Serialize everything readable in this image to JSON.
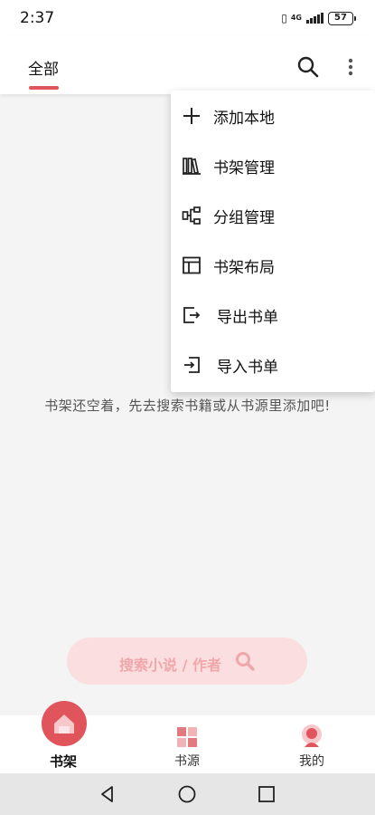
{
  "status_bar": {
    "time": "2:37",
    "network": "4G",
    "battery": "57"
  },
  "header": {
    "tab_label": "全部",
    "accent_color": "#e0555c"
  },
  "menu": {
    "items": [
      {
        "label": "添加本地",
        "icon": "plus-icon"
      },
      {
        "label": "书架管理",
        "icon": "bookshelf-icon"
      },
      {
        "label": "分组管理",
        "icon": "group-tree-icon"
      },
      {
        "label": "书架布局",
        "icon": "layout-icon"
      },
      {
        "label": "导出书单",
        "icon": "export-icon"
      },
      {
        "label": "导入书单",
        "icon": "import-icon"
      }
    ]
  },
  "empty_state": {
    "message": "书架还空着，先去搜索书籍或从书源里添加吧!"
  },
  "search_pill": {
    "label": "搜索小说 / 作者"
  },
  "bottom_nav": {
    "items": [
      {
        "label": "书架",
        "icon": "home-icon",
        "active": true
      },
      {
        "label": "书源",
        "icon": "book-source-icon",
        "active": false
      },
      {
        "label": "我的",
        "icon": "profile-icon",
        "active": false
      }
    ]
  },
  "system_nav": {
    "buttons": [
      "back-icon",
      "home-circle-icon",
      "recents-icon"
    ]
  }
}
